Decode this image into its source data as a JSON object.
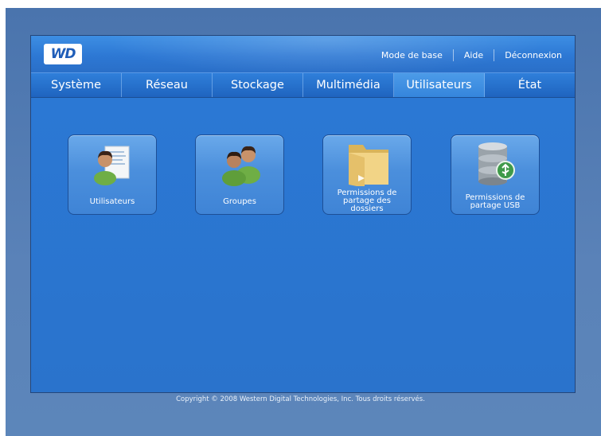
{
  "header": {
    "logo_text": "WD",
    "links": {
      "basic_mode": "Mode de base",
      "help": "Aide",
      "logout": "Déconnexion"
    }
  },
  "tabs": [
    {
      "label": "Système"
    },
    {
      "label": "Réseau"
    },
    {
      "label": "Stockage"
    },
    {
      "label": "Multimédia"
    },
    {
      "label": "Utilisateurs",
      "active": true
    },
    {
      "label": "État"
    }
  ],
  "tiles": [
    {
      "label": "Utilisateurs",
      "icon": "user-document-icon"
    },
    {
      "label": "Groupes",
      "icon": "group-users-icon"
    },
    {
      "label": "Permissions de partage des dossiers",
      "icon": "folder-icon"
    },
    {
      "label": "Permissions de partage USB",
      "icon": "usb-database-icon"
    }
  ],
  "footer": {
    "copyright": "Copyright © 2008 Western Digital Technologies, Inc. Tous droits réservés."
  },
  "colors": {
    "background": "#5a82b8",
    "panel": "#2b74ce",
    "tile": "#4b8fdc",
    "logo": "#1f5db8"
  }
}
